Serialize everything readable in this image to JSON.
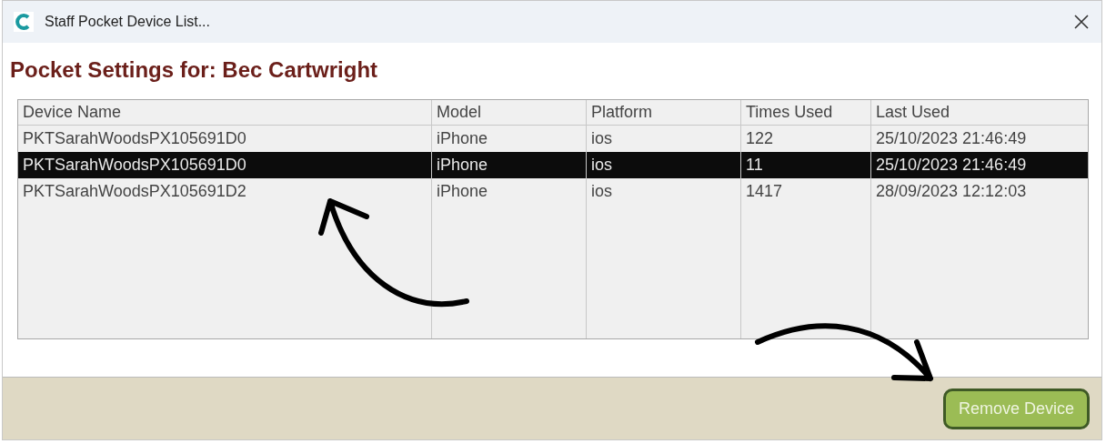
{
  "window": {
    "title": "Staff Pocket Device List..."
  },
  "heading": "Pocket Settings for: Bec Cartwright",
  "table": {
    "columns": [
      "Device Name",
      "Model",
      "Platform",
      "Times Used",
      "Last Used"
    ],
    "rows": [
      {
        "cells": [
          "PKTSarahWoodsPX105691D0",
          "iPhone",
          "ios",
          "122",
          "25/10/2023 21:46:49"
        ],
        "selected": false
      },
      {
        "cells": [
          "PKTSarahWoodsPX105691D0",
          "iPhone",
          "ios",
          "11",
          "25/10/2023 21:46:49"
        ],
        "selected": true
      },
      {
        "cells": [
          "PKTSarahWoodsPX105691D2",
          "iPhone",
          "ios",
          "1417",
          "28/09/2023 12:12:03"
        ],
        "selected": false
      }
    ]
  },
  "buttons": [
    "Remove Device"
  ]
}
